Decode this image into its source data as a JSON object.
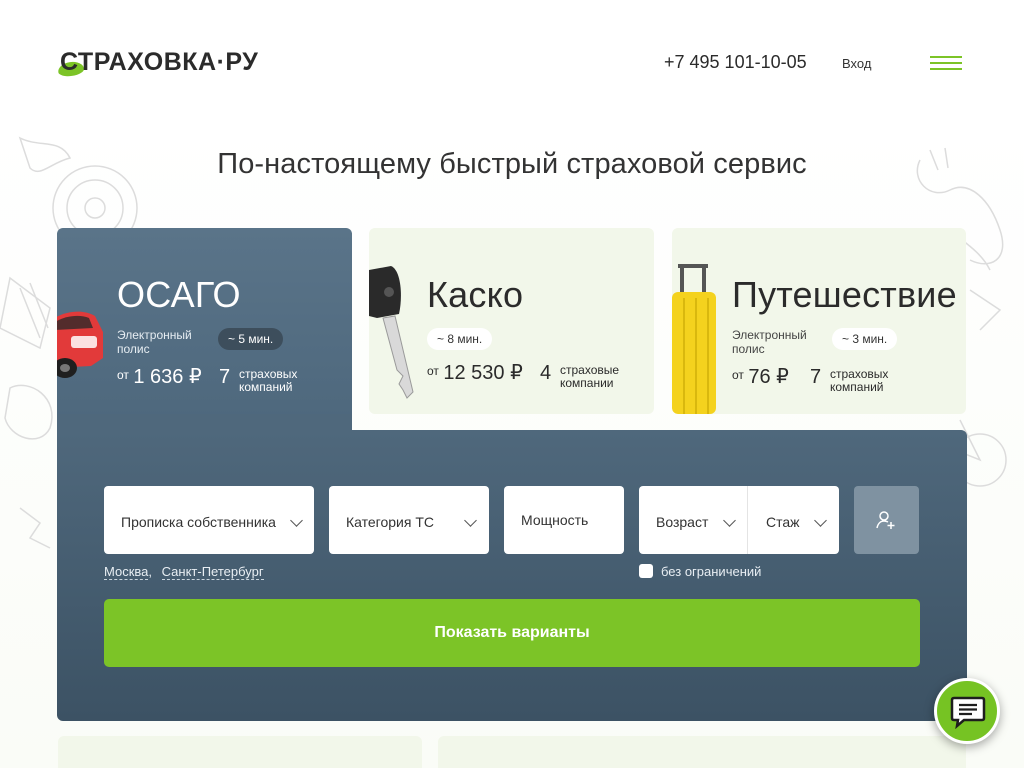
{
  "header": {
    "logo_text": "СТРАХОВКА·РУ",
    "phone": "+7 495 101-10-05",
    "login": "Вход"
  },
  "headline": "По-настоящему быстрый страховой сервис",
  "products": {
    "osago": {
      "title": "ОСАГО",
      "subtitle": "Электронный полис",
      "time": "~ 5 мин.",
      "price_prefix": "от",
      "price": "1 636 ₽",
      "companies_count": "7",
      "companies_label": "страховых компаний"
    },
    "kasko": {
      "title": "Каско",
      "time": "~ 8 мин.",
      "price_prefix": "от",
      "price": "12 530 ₽",
      "companies_count": "4",
      "companies_label": "страховые компании"
    },
    "travel": {
      "title": "Путешествие",
      "subtitle": "Электронный полис",
      "time": "~ 3 мин.",
      "price_prefix": "от",
      "price": "76 ₽",
      "companies_count": "7",
      "companies_label": "страховых компаний"
    }
  },
  "form": {
    "registration_label": "Прописка собственника",
    "category_label": "Категория ТС",
    "power_placeholder": "Мощность",
    "age_label": "Возраст",
    "experience_label": "Стаж",
    "cities": [
      "Москва",
      "Санкт-Петербург"
    ],
    "no_limit_label": "без ограничений",
    "submit_label": "Показать варианты"
  },
  "colors": {
    "brand_green": "#7cc427",
    "panel_slate": "#4f687c",
    "card_bg": "#f2f7ea"
  },
  "icons": {
    "add_driver": "add-user-icon",
    "chat": "chat-icon",
    "menu": "menu-icon"
  }
}
